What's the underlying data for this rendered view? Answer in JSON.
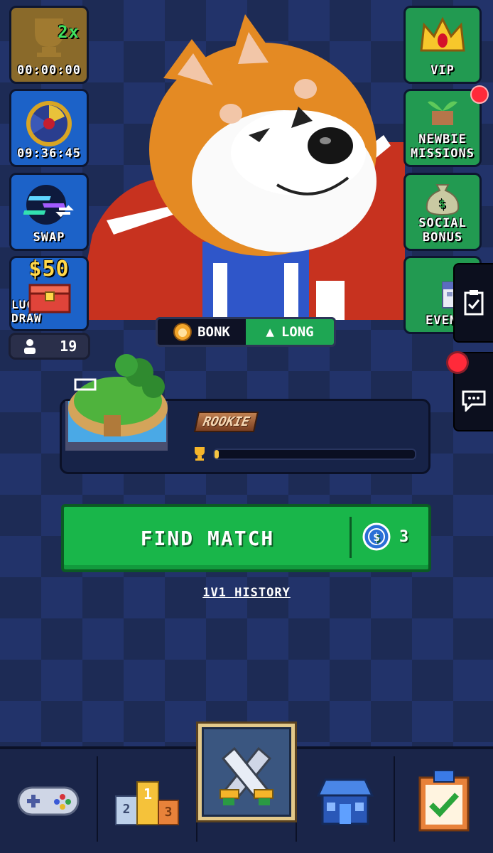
{
  "left_tiles": {
    "boost": {
      "badge": "2x",
      "timer": "00:00:00"
    },
    "spin": {
      "timer": "09:36:45"
    },
    "swap": {
      "label": "SWAP"
    },
    "lucky_draw": {
      "amount": "$50",
      "label": "LUCKY DRAW"
    },
    "players_online": {
      "count": "19"
    }
  },
  "right_tiles": {
    "vip": {
      "label": "VIP"
    },
    "newbie": {
      "label_line1": "NEWBIE",
      "label_line2": "MISSIONS"
    },
    "social": {
      "label_line1": "SOCIAL",
      "label_line2": "BONUS"
    },
    "events": {
      "label": "EVEN"
    }
  },
  "token": {
    "symbol": "BONK",
    "direction": "LONG"
  },
  "rank": {
    "tier": "ROOKIE",
    "progress": 0.02
  },
  "find_match": {
    "label": "FIND MATCH",
    "cost": "3"
  },
  "history": {
    "label": "1V1 HISTORY"
  },
  "colors": {
    "accent_green": "#19b64a",
    "tile_blue": "#1c62c8",
    "tile_green": "#229a51",
    "notify_red": "#ff2a3a"
  }
}
